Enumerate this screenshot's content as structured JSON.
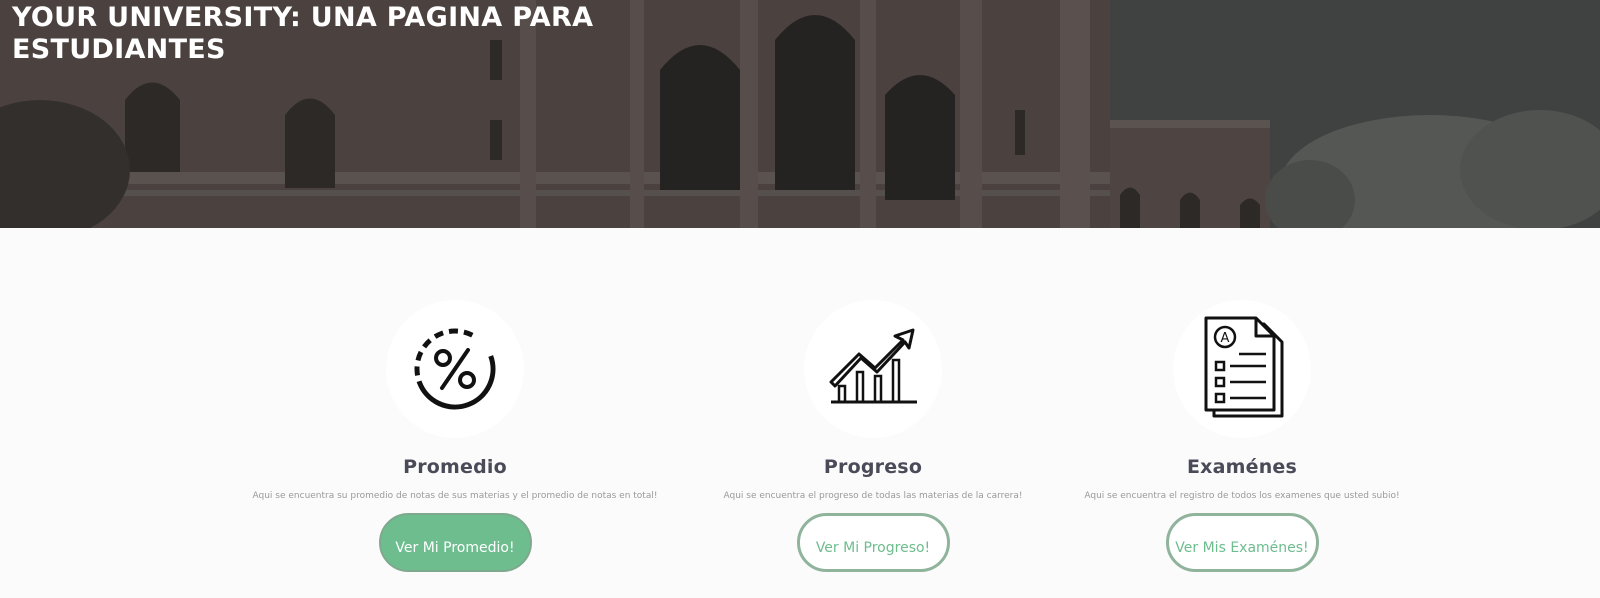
{
  "hero": {
    "title_bold": "YOUR UNIVERSITY:",
    "title_rest": " UNA PAGINA PARA ESTUDIANTES"
  },
  "cards": [
    {
      "icon": "percent-icon",
      "title": "Promedio",
      "description": "Aqui se encuentra su promedio de notas de sus materias y el promedio de notas en total!",
      "button_label": "Ver Mi Promedio!",
      "button_style": "filled"
    },
    {
      "icon": "growth-chart-icon",
      "title": "Progreso",
      "description": "Aqui se encuentra el progreso de todas las materias de la carrera!",
      "button_label": "Ver Mi Progreso!",
      "button_style": "outline"
    },
    {
      "icon": "exam-document-icon",
      "title": "Examénes",
      "description": "Aqui se encuentra el registro de todos los examenes que usted subio!",
      "button_label": "Ver Mis Examénes!",
      "button_style": "outline"
    }
  ],
  "colors": {
    "accent": "#6dbd8e",
    "title_text": "#4a4a58",
    "description_text": "#9a9a9a"
  }
}
